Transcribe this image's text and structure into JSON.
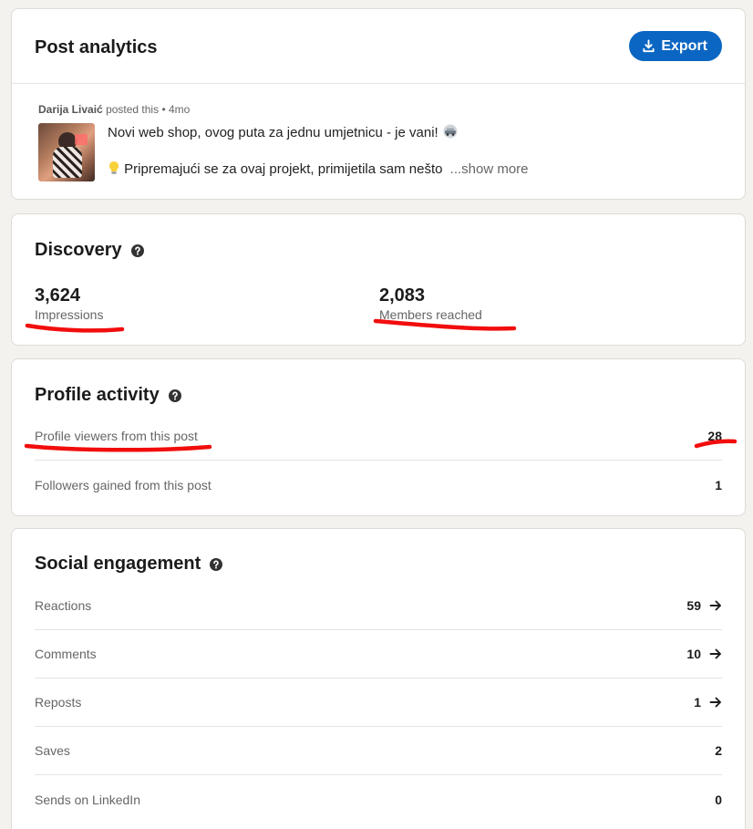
{
  "header": {
    "title": "Post analytics",
    "export_label": "Export"
  },
  "post": {
    "author": "Darija Livaić",
    "action": "posted this",
    "separator": "•",
    "age": "4mo",
    "line1": "Novi web shop, ovog puta za jednu umjetnicu - je vani!",
    "line2": "Pripremajući se za ovaj projekt, primijetila sam nešto",
    "show_more": "...show more"
  },
  "discovery": {
    "title": "Discovery",
    "impressions_value": "3,624",
    "impressions_label": "Impressions",
    "members_value": "2,083",
    "members_label": "Members reached"
  },
  "profile_activity": {
    "title": "Profile activity",
    "rows": [
      {
        "label": "Profile viewers from this post",
        "value": "28"
      },
      {
        "label": "Followers gained from this post",
        "value": "1"
      }
    ]
  },
  "social_engagement": {
    "title": "Social engagement",
    "rows": [
      {
        "label": "Reactions",
        "value": "59"
      },
      {
        "label": "Comments",
        "value": "10"
      },
      {
        "label": "Reposts",
        "value": "1"
      },
      {
        "label": "Saves",
        "value": "2"
      },
      {
        "label": "Sends on LinkedIn",
        "value": "0"
      }
    ]
  },
  "colors": {
    "brand_blue": "#0a66c2",
    "annotation_red": "#f20d0d",
    "page_background": "#f4f2ee"
  }
}
